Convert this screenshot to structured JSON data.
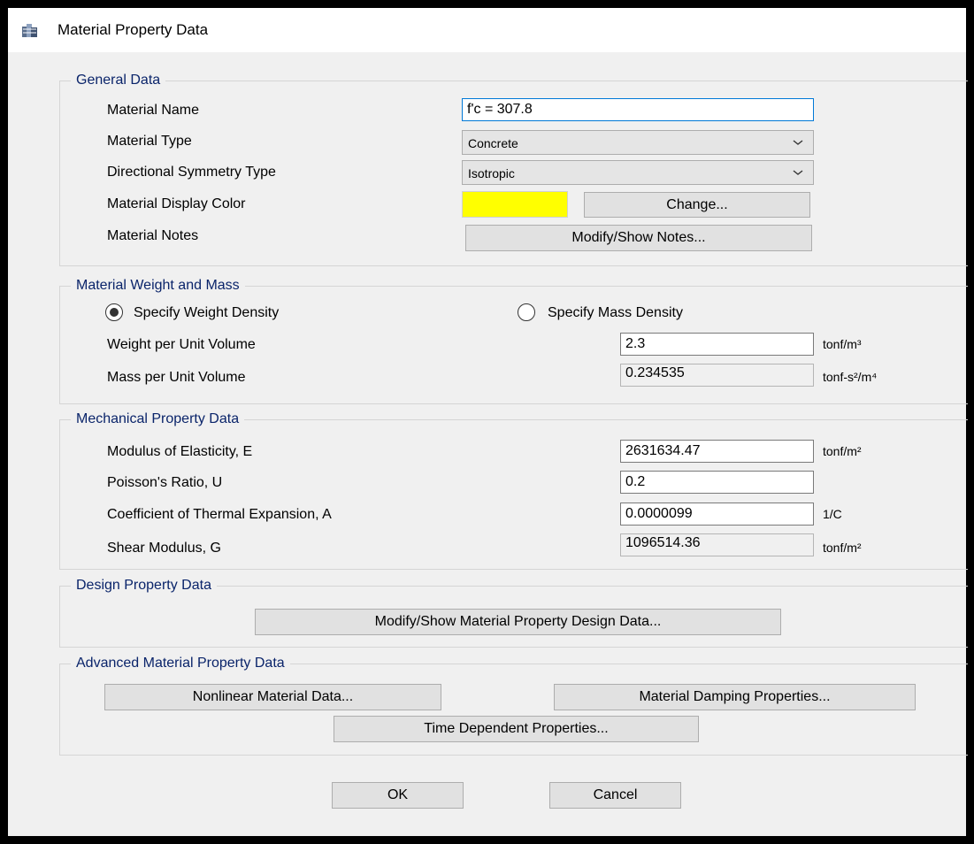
{
  "window": {
    "title": "Material Property Data",
    "icon": "material-icon"
  },
  "general": {
    "label": "General Data",
    "material_name_label": "Material Name",
    "material_name_value": "f'c = 307.8",
    "material_type_label": "Material Type",
    "material_type_value": "Concrete",
    "symmetry_label": "Directional Symmetry Type",
    "symmetry_value": "Isotropic",
    "display_color_label": "Material Display Color",
    "display_color": "#ffff00",
    "change_button": "Change...",
    "notes_label": "Material Notes",
    "notes_button": "Modify/Show Notes..."
  },
  "weight": {
    "label": "Material Weight and Mass",
    "radio_weight": "Specify Weight Density",
    "radio_mass": "Specify Mass Density",
    "selected": "weight",
    "weight_label": "Weight per Unit Volume",
    "weight_value": "2.3",
    "weight_unit": "tonf/m³",
    "mass_label": "Mass per Unit Volume",
    "mass_value": "0.234535",
    "mass_unit": "tonf-s²/m⁴"
  },
  "mechanical": {
    "label": "Mechanical Property Data",
    "e_label": "Modulus of Elasticity,  E",
    "e_value": "2631634.47",
    "e_unit": "tonf/m²",
    "u_label": "Poisson's Ratio,  U",
    "u_value": "0.2",
    "a_label": "Coefficient of Thermal Expansion,  A",
    "a_value": "0.0000099",
    "a_unit": "1/C",
    "g_label": "Shear Modulus,  G",
    "g_value": "1096514.36",
    "g_unit": "tonf/m²"
  },
  "design": {
    "label": "Design Property Data",
    "button": "Modify/Show Material Property Design Data..."
  },
  "advanced": {
    "label": "Advanced Material Property Data",
    "nonlinear_button": "Nonlinear Material Data...",
    "damping_button": "Material Damping Properties...",
    "time_button": "Time Dependent Properties..."
  },
  "footer": {
    "ok": "OK",
    "cancel": "Cancel"
  }
}
